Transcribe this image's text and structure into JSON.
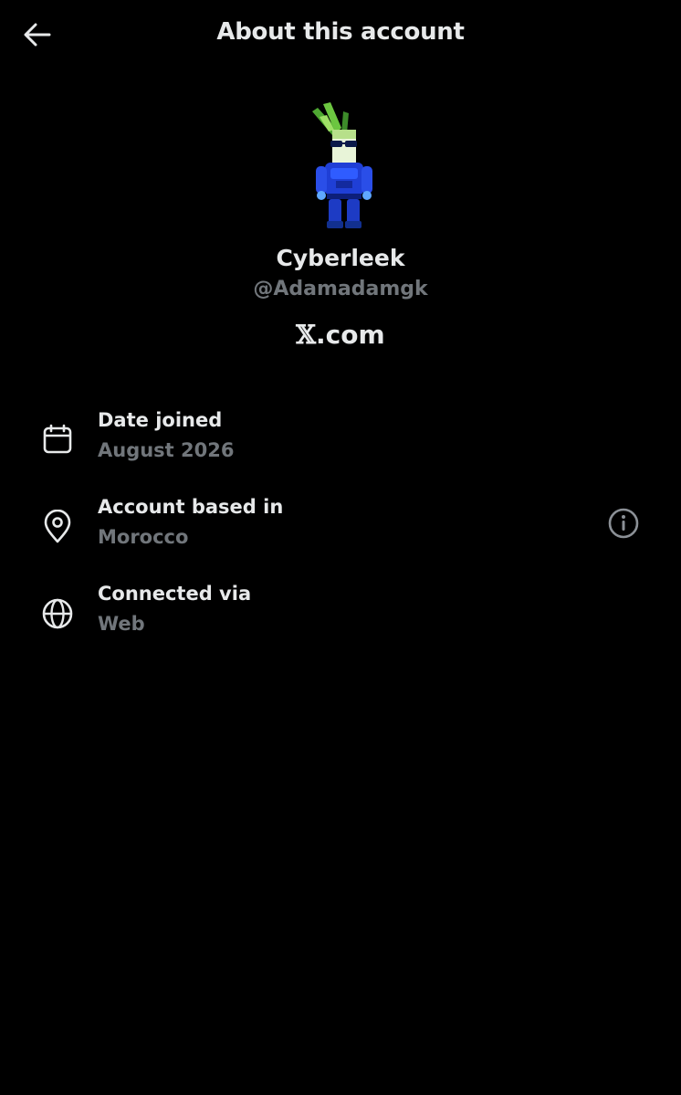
{
  "header": {
    "title": "About this account",
    "back_icon": "arrow-left-icon"
  },
  "profile": {
    "display_name": "Cyberleek",
    "handle": "@Adamadamgk",
    "avatar_icon": "pixel-art-leek-robot-avatar",
    "site_mark": "𝕏",
    "site_suffix": ".com"
  },
  "details": [
    {
      "icon": "calendar-icon",
      "label": "Date joined",
      "value": "August 2026"
    },
    {
      "icon": "location-pin-icon",
      "label": "Account based in",
      "value": "Morocco",
      "info_icon": "info-circle-icon"
    },
    {
      "icon": "globe-icon",
      "label": "Connected via",
      "value": "Web"
    }
  ],
  "colors": {
    "background": "#000000",
    "primary_text": "#e7e9ea",
    "secondary_text": "#71767b"
  }
}
